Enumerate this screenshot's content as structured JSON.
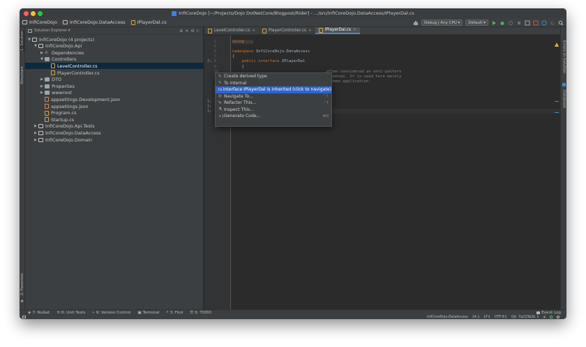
{
  "window": {
    "title": "InfiCoreDojo [~/Projects/Dojo DotNetCore/Blogpost/Rider] - .../src/InfiCoreDojo.DataAccess/IPlayerDal.cs",
    "traffic_lights": [
      "#fe5f57",
      "#febc2e",
      "#28c840"
    ]
  },
  "navbar": {
    "breadcrumbs": [
      "InfiCoreDojo",
      "InfiCoreDojo.DataAccess",
      "IPlayerDal.cs"
    ],
    "config_combo": "Debug | Any CPU ▾",
    "run_combo": "Default ▾"
  },
  "left_strip": {
    "solution_tab": "1: Solution",
    "structure_tab": "Structure",
    "favorites_tab": "2: Favorites"
  },
  "right_strip": {
    "errors_tab": "Errors In Solution",
    "database_tab": "Database"
  },
  "explorer": {
    "header": "Solution Explorer ▾",
    "tree": [
      {
        "indent": 0,
        "twisty": "▼",
        "icon": "solution-icon",
        "kind": "proj",
        "label": "InfiCoreDojo (4 projects)"
      },
      {
        "indent": 1,
        "twisty": "▼",
        "icon": "project-icon",
        "kind": "proj",
        "label": "InfiCoreDojo.Api"
      },
      {
        "indent": 2,
        "twisty": "▶",
        "icon": "dependencies-icon",
        "kind": "dep",
        "label": "Dependencies"
      },
      {
        "indent": 2,
        "twisty": "▼",
        "icon": "folder-icon",
        "kind": "folder",
        "label": "Controllers"
      },
      {
        "indent": 3,
        "twisty": "",
        "icon": "csharp-file-icon",
        "kind": "cs",
        "label": "LevelController.cs",
        "selected": true
      },
      {
        "indent": 3,
        "twisty": "",
        "icon": "csharp-file-icon",
        "kind": "cs",
        "label": "PlayerController.cs"
      },
      {
        "indent": 2,
        "twisty": "▶",
        "icon": "folder-icon",
        "kind": "folder",
        "label": "DTO"
      },
      {
        "indent": 2,
        "twisty": "▶",
        "icon": "folder-icon",
        "kind": "folder",
        "label": "Properties"
      },
      {
        "indent": 2,
        "twisty": "▶",
        "icon": "folder-icon",
        "kind": "folder",
        "label": "wwwroot"
      },
      {
        "indent": 2,
        "twisty": "",
        "icon": "json-file-icon",
        "kind": "json",
        "label": "appsettings.Development.json"
      },
      {
        "indent": 2,
        "twisty": "",
        "icon": "json-file-icon",
        "kind": "json",
        "label": "appsettings.json"
      },
      {
        "indent": 2,
        "twisty": "",
        "icon": "csharp-file-icon",
        "kind": "cs",
        "label": "Program.cs"
      },
      {
        "indent": 2,
        "twisty": "",
        "icon": "csharp-file-icon",
        "kind": "cs",
        "label": "Startup.cs"
      },
      {
        "indent": 1,
        "twisty": "▶",
        "icon": "project-icon",
        "kind": "proj",
        "label": "InfiCoreDojo.Api.Tests"
      },
      {
        "indent": 1,
        "twisty": "▶",
        "icon": "project-icon",
        "kind": "proj",
        "label": "InfiCoreDojo.DataAccess"
      },
      {
        "indent": 1,
        "twisty": "▶",
        "icon": "project-icon",
        "kind": "proj",
        "label": "InfiCoreDojo.Domain"
      }
    ]
  },
  "editor": {
    "tabs": [
      {
        "label": "LevelController.cs",
        "active": false
      },
      {
        "label": "PlayerController.cs",
        "active": false
      },
      {
        "label": "IPlayerDal.cs",
        "active": true
      }
    ],
    "lines": [
      {
        "n": "1",
        "mark": "",
        "code": [
          {
            "t": "using ...",
            "c": "hl-using"
          }
        ]
      },
      {
        "n": "5",
        "mark": "",
        "code": []
      },
      {
        "n": "6",
        "mark": "",
        "code": [
          {
            "t": "namespace ",
            "c": "kw"
          },
          {
            "t": "InfiCoreDojo.DataAccess",
            "c": ""
          }
        ]
      },
      {
        "n": "7",
        "mark": "",
        "code": [
          {
            "t": "{",
            "c": ""
          }
        ]
      },
      {
        "n": "8",
        "mark": "I↓",
        "code": [
          {
            "t": "    public interface ",
            "c": "kw"
          },
          {
            "t": "IPlayerDal",
            "c": ""
          }
        ]
      },
      {
        "n": "9",
        "mark": "",
        "code": [
          {
            "t": "    {",
            "c": ""
          }
        ]
      },
      {
        "n": "10",
        "mark": "",
        "code": [
          {
            "t": "                                        often considered an anti-pattern",
            "c": "cm"
          }
        ]
      },
      {
        "n": "11",
        "mark": "",
        "code": [
          {
            "t": "                                        equences. It is used here merely",
            "c": "cm"
          }
        ]
      },
      {
        "n": "12",
        "mark": "",
        "code": [
          {
            "t": "                                        s demo application.",
            "c": "cm"
          }
        ]
      },
      {
        "n": "13",
        "mark": "",
        "code": []
      },
      {
        "n": "14",
        "mark": "",
        "code": []
      },
      {
        "n": "15",
        "mark": "",
        "code": []
      },
      {
        "n": "16",
        "mark": "I↓",
        "code": []
      },
      {
        "n": "17",
        "mark": "I↓",
        "code": []
      },
      {
        "n": "18",
        "mark": "I↓",
        "code": [
          {
            "t": "        void ",
            "c": "kw"
          },
          {
            "t": "Upsert",
            "c": "fn"
          },
          {
            "t": "(Player player);",
            "c": ""
          }
        ]
      },
      {
        "n": "19",
        "mark": "",
        "code": [
          {
            "t": "    }",
            "c": ""
          }
        ]
      },
      {
        "n": "20",
        "mark": "",
        "code": [
          {
            "t": "}",
            "c": ""
          }
        ]
      },
      {
        "n": "21",
        "mark": "",
        "code": []
      }
    ]
  },
  "popup": {
    "items": [
      {
        "icon": "↖",
        "label": "Create derived type",
        "shortcut": "",
        "selected": false
      },
      {
        "icon": "↖",
        "label": "To internal",
        "shortcut": "",
        "selected": false
      },
      {
        "icon": "I↓",
        "label": "interface IPlayerDal is inherited (click to navigate)",
        "shortcut": "",
        "selected": true
      },
      {
        "icon": "◎",
        "label": "Navigate To...",
        "shortcut": "⌃⇧",
        "selected": false
      },
      {
        "icon": "✎",
        "label": "Refactor This...",
        "shortcut": "⌃T",
        "selected": false
      },
      {
        "icon": "⚗",
        "label": "Inspect This...",
        "shortcut": "",
        "selected": false
      },
      {
        "icon": "+}",
        "label": "Generate Code...",
        "shortcut": "⌘N",
        "selected": false
      }
    ]
  },
  "bottom_tabs": [
    {
      "icon": "nuget-icon",
      "glyph": "◈",
      "label": "7: NuGet"
    },
    {
      "icon": "unit-tests-icon",
      "glyph": "⟲",
      "label": "8: Unit Tests"
    },
    {
      "icon": "version-control-icon",
      "glyph": "⑂",
      "label": "9: Version Control"
    },
    {
      "icon": "terminal-icon",
      "glyph": "▣",
      "label": "Terminal"
    },
    {
      "icon": "find-icon",
      "glyph": "⌕",
      "label": "3: Find"
    },
    {
      "icon": "todo-icon",
      "glyph": "☰",
      "label": "6: TODO"
    }
  ],
  "event_log": "Event Log",
  "status": {
    "project": "InfiCoreDojo.DataAccess",
    "position": "14:1",
    "line_sep": "LF↕",
    "encoding": "UTF-8↕",
    "git": "Git: 7a223b2b ↕"
  }
}
